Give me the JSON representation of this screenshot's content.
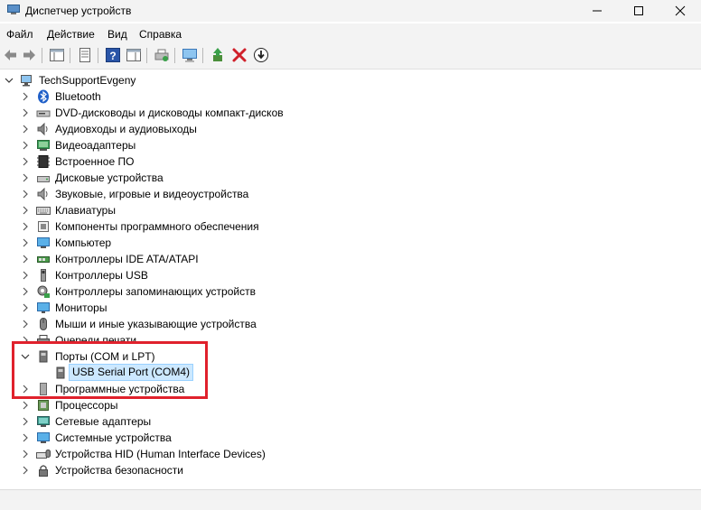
{
  "window": {
    "title": "Диспетчер устройств"
  },
  "menu": [
    "Файл",
    "Действие",
    "Вид",
    "Справка"
  ],
  "tree": {
    "root": "TechSupportEvgeny",
    "items": [
      {
        "label": "Bluetooth",
        "icon": "bluetooth-icon"
      },
      {
        "label": "DVD-дисководы и дисководы компакт-дисков",
        "icon": "dvd-drive-icon"
      },
      {
        "label": "Аудиовходы и аудиовыходы",
        "icon": "speaker-icon"
      },
      {
        "label": "Видеоадаптеры",
        "icon": "display-adapter-icon"
      },
      {
        "label": "Встроенное ПО",
        "icon": "firmware-chip-icon"
      },
      {
        "label": "Дисковые устройства",
        "icon": "disk-drive-icon"
      },
      {
        "label": "Звуковые, игровые и видеоустройства",
        "icon": "sound-icon"
      },
      {
        "label": "Клавиатуры",
        "icon": "keyboard-icon"
      },
      {
        "label": "Компоненты программного обеспечения",
        "icon": "software-component-icon"
      },
      {
        "label": "Компьютер",
        "icon": "computer-icon"
      },
      {
        "label": "Контроллеры IDE ATA/ATAPI",
        "icon": "ide-controller-icon"
      },
      {
        "label": "Контроллеры USB",
        "icon": "usb-controller-icon"
      },
      {
        "label": "Контроллеры запоминающих устройств",
        "icon": "storage-controller-icon"
      },
      {
        "label": "Мониторы",
        "icon": "monitor-icon"
      },
      {
        "label": "Мыши и иные указывающие устройства",
        "icon": "mouse-icon"
      },
      {
        "label": "Очереди печати",
        "icon": "printer-icon"
      },
      {
        "label": "Порты (COM и LPT)",
        "icon": "port-icon",
        "expanded": true
      },
      {
        "label": "USB Serial Port (COM4)",
        "icon": "port-icon",
        "child": true,
        "selected": true
      },
      {
        "label": "Программные устройства",
        "icon": "software-device-icon"
      },
      {
        "label": "Процессоры",
        "icon": "processor-icon"
      },
      {
        "label": "Сетевые адаптеры",
        "icon": "network-adapter-icon"
      },
      {
        "label": "Системные устройства",
        "icon": "system-device-icon"
      },
      {
        "label": "Устройства HID (Human Interface Devices)",
        "icon": "hid-icon"
      },
      {
        "label": "Устройства безопасности",
        "icon": "security-device-icon"
      }
    ]
  },
  "colors": {
    "chrome": "#f3f3f3",
    "selection": "#cce8ff",
    "selection_border": "#99d1ff",
    "highlight": "#e0212c"
  }
}
